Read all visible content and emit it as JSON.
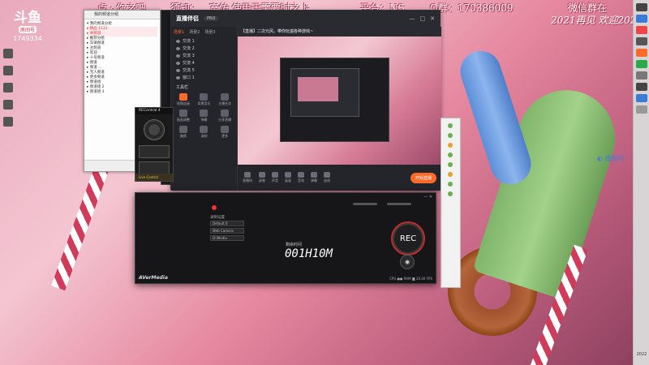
{
  "banner": {
    "segments": [
      "点 · 你之吧",
      "须知：",
      "室仿  使用于需要时之上",
      "平台：NS",
      "Q群：170386009",
      "微信群在"
    ],
    "date_line": "2021再见  欢迎2022"
  },
  "douyu": {
    "logo": "斗鱼",
    "room_label": "房间号",
    "room_id": "1749334"
  },
  "qq_window": {
    "title": "我的频道分组",
    "rows": [
      "▾ 我的频道分组",
      "  ▸ 精品 1111",
      "  ▸ 本频道",
      "  ▸ 推荐分组",
      "  ▸ 车辆频道",
      "  ▸ 主频道",
      "  ▸ 欢迎  ·",
      "  ▸ 十号频道",
      "  ▸ 频道",
      "  ▸ 频道 …",
      "  ▸ 无人频道",
      "  ▸ 更多频道",
      "  ▸ 频道组",
      "  ▸ 频道组 2",
      "  ▸ 频道组 3"
    ]
  },
  "dark_panel": {
    "rows": [
      "通道 1",
      "通道 2",
      "通道 3",
      "通道 4",
      "通道 5",
      "通道 6"
    ]
  },
  "live_app": {
    "logo": "直播伴侣",
    "badge": "PRO",
    "scene_tabs": [
      "场景1",
      "场景2",
      "场景3"
    ],
    "sources": [
      "交流 1",
      "交流 2",
      "交流 3",
      "交流 4",
      "交流 5",
      "窗口 1"
    ],
    "tools_title": "工具栏",
    "tools": [
      "视频连接",
      "背景音乐",
      "主播任务",
      "画面调整",
      "弹幕",
      "分享直播",
      "美颜",
      "录制",
      "更多"
    ],
    "preview_title": "【直播】二次元风，带你玩遍各种游戏~",
    "bottom_items": [
      "直播间",
      "录制",
      "声音",
      "画面",
      "音效",
      "弹幕",
      "连线"
    ],
    "start_button": "开始直播"
  },
  "rec_small": {
    "title": "RECentral 4",
    "live_label": "Live Control"
  },
  "avm": {
    "title": "RECentral",
    "labels": {
      "record_settings": "录制设置",
      "source": "Default 0",
      "format": "Web Camera",
      "path": "D:\\Media"
    },
    "elapsed_label": "剩余时间",
    "elapsed": "001H10M",
    "rec_label": "REC",
    "logo": "AVerMedia",
    "status": "CPU ●● RAM  ◙ 20.00  FPS"
  },
  "side_caption": "◐ 播放问",
  "taskbar": {
    "clock": "2022"
  }
}
